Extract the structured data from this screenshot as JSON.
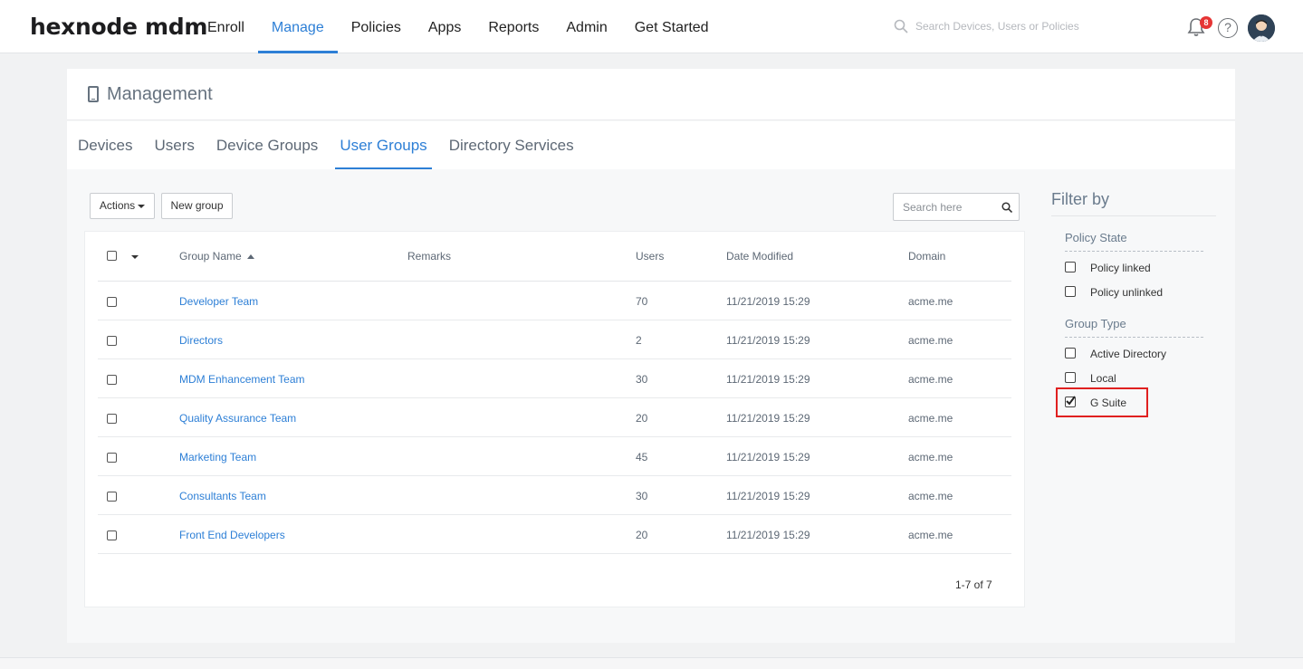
{
  "brand": {
    "logo": "hexnode mdm"
  },
  "nav": {
    "items": [
      "Enroll",
      "Manage",
      "Policies",
      "Apps",
      "Reports",
      "Admin",
      "Get Started"
    ],
    "active": "Manage"
  },
  "top_search": {
    "placeholder": "Search Devices, Users or Policies"
  },
  "notifications": {
    "count": "8"
  },
  "help": {
    "glyph": "?"
  },
  "management": {
    "title": "Management",
    "tabs": [
      "Devices",
      "Users",
      "Device Groups",
      "User Groups",
      "Directory Services"
    ],
    "active_tab": "User Groups"
  },
  "toolbar": {
    "actions_label": "Actions",
    "new_group_label": "New group",
    "search_placeholder": "Search here"
  },
  "table": {
    "columns": [
      "Group Name",
      "Remarks",
      "Users",
      "Date Modified",
      "Domain"
    ],
    "rows": [
      {
        "name": "Developer Team",
        "remarks": "",
        "users": "70",
        "date": "11/21/2019 15:29",
        "domain": "acme.me"
      },
      {
        "name": "Directors",
        "remarks": "",
        "users": "2",
        "date": "11/21/2019 15:29",
        "domain": "acme.me"
      },
      {
        "name": "MDM Enhancement Team",
        "remarks": "",
        "users": "30",
        "date": "11/21/2019 15:29",
        "domain": "acme.me"
      },
      {
        "name": "Quality Assurance Team",
        "remarks": "",
        "users": "20",
        "date": "11/21/2019 15:29",
        "domain": "acme.me"
      },
      {
        "name": "Marketing Team",
        "remarks": "",
        "users": "45",
        "date": "11/21/2019 15:29",
        "domain": "acme.me"
      },
      {
        "name": "Consultants Team",
        "remarks": "",
        "users": "30",
        "date": "11/21/2019 15:29",
        "domain": "acme.me"
      },
      {
        "name": "Front End Developers",
        "remarks": "",
        "users": "20",
        "date": "11/21/2019 15:29",
        "domain": "acme.me"
      }
    ],
    "pagination": "1-7 of 7"
  },
  "filter": {
    "title": "Filter by",
    "policy_state": {
      "label": "Policy State",
      "options": [
        {
          "label": "Policy linked",
          "checked": false
        },
        {
          "label": "Policy unlinked",
          "checked": false
        }
      ]
    },
    "group_type": {
      "label": "Group Type",
      "options": [
        {
          "label": "Active Directory",
          "checked": false
        },
        {
          "label": "Local",
          "checked": false
        },
        {
          "label": "G Suite",
          "checked": true
        }
      ]
    }
  },
  "colors": {
    "accent": "#2d7fd6",
    "highlight": "#e02020",
    "badge": "#e63535"
  }
}
